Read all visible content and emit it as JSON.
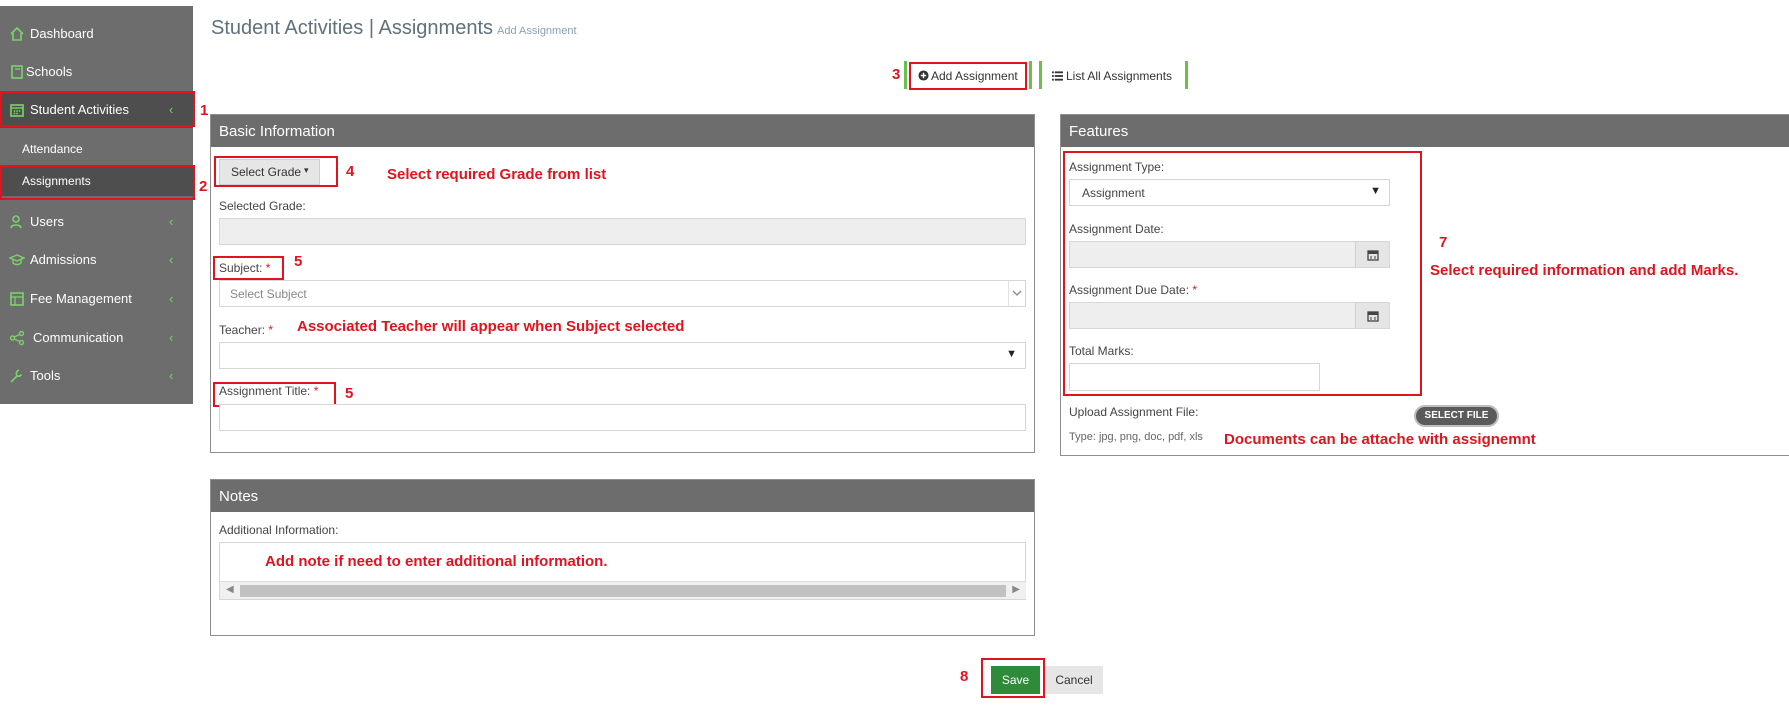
{
  "sidebar": {
    "items": [
      {
        "label": "Dashboard",
        "icon": "home-icon"
      },
      {
        "label": "Schools",
        "icon": "book-icon"
      },
      {
        "label": "Student Activities",
        "icon": "calendar-icon"
      },
      {
        "label": "Users",
        "icon": "user-icon"
      },
      {
        "label": "Admissions",
        "icon": "graduation-cap-icon"
      },
      {
        "label": "Fee Management",
        "icon": "table-icon"
      },
      {
        "label": "Communication",
        "icon": "share-icon"
      },
      {
        "label": "Tools",
        "icon": "wrench-icon"
      }
    ],
    "subitems": [
      {
        "label": "Attendance"
      },
      {
        "label": "Assignments"
      }
    ],
    "chevron": "‹"
  },
  "header": {
    "title": "Student Activities | Assignments",
    "subtitle": "Add Assignment"
  },
  "toolbar": {
    "add_label": "Add Assignment",
    "list_label": "List All Assignments"
  },
  "basic": {
    "heading": "Basic Information",
    "grade_button": "Select Grade",
    "selected_grade_label": "Selected Grade:",
    "subject_label": "Subject:",
    "subject_placeholder": "Select Subject",
    "teacher_label": "Teacher:",
    "title_label": "Assignment Title:",
    "required_mark": "*"
  },
  "features": {
    "heading": "Features",
    "type_label": "Assignment Type:",
    "type_value": "Assignment",
    "date_label": "Assignment Date:",
    "due_label": "Assignment Due Date:",
    "marks_label": "Total Marks:",
    "upload_label": "Upload Assignment File:",
    "file_types": "Type: jpg, png, doc, pdf, xls",
    "select_file": "SELECT FILE"
  },
  "notes": {
    "heading": "Notes",
    "info_label": "Additional Information:"
  },
  "actions": {
    "save": "Save",
    "cancel": "Cancel"
  },
  "annotations": {
    "n1": "1",
    "n2": "2",
    "n3": "3",
    "n4": "4",
    "n5a": "5",
    "n5b": "5",
    "n7": "7",
    "n8": "8",
    "grade_hint": "Select required Grade from list",
    "teacher_hint": "Associated Teacher will appear when Subject selected",
    "features_hint": "Select required information and add Marks.",
    "docs_hint": "Documents can be attache with assignemnt",
    "notes_hint": "Add note if need to enter additional information."
  },
  "colors": {
    "sidebar_bg": "#6d6d6d",
    "accent_green": "#6cc04a",
    "annotation_red": "#e0141e",
    "save_green": "#2e8b3a"
  }
}
